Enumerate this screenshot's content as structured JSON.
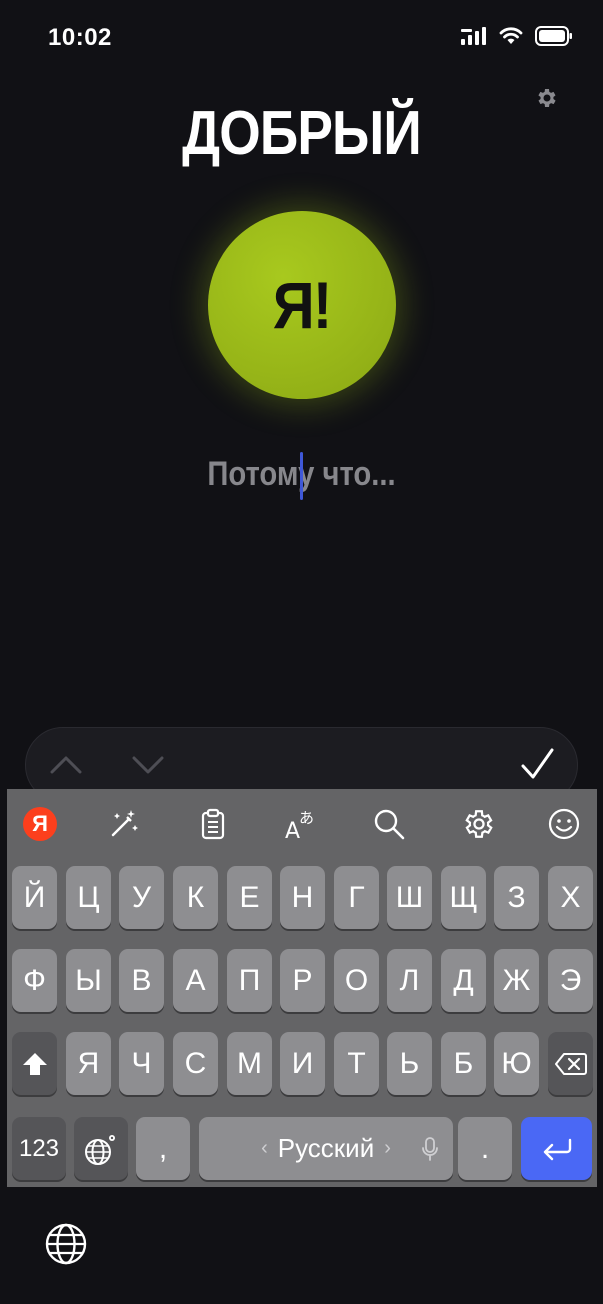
{
  "status": {
    "time": "10:02"
  },
  "screen": {
    "headline": "ДОБРЫЙ",
    "circle_label": "Я!",
    "prompt_text": "Потому что...",
    "accent_color": "#97b518",
    "caret_color": "#3f58d8"
  },
  "keyboard": {
    "language_label": "Русский",
    "toolbar_icons": [
      "yandex-logo",
      "magic-wand-icon",
      "clipboard-icon",
      "translate-icon",
      "search-icon",
      "gear-icon",
      "emoji-icon"
    ],
    "yandex_letter": "Я",
    "row1": [
      "Й",
      "Ц",
      "У",
      "К",
      "Е",
      "Н",
      "Г",
      "Ш",
      "Щ",
      "З",
      "Х"
    ],
    "row2": [
      "Ф",
      "Ы",
      "В",
      "А",
      "П",
      "Р",
      "О",
      "Л",
      "Д",
      "Ж",
      "Э"
    ],
    "row3": [
      "Я",
      "Ч",
      "С",
      "М",
      "И",
      "Т",
      "Ь",
      "Б",
      "Ю"
    ],
    "numbers_label": "123",
    "comma_label": ",",
    "period_label": ".",
    "left_arrow": "‹",
    "right_arrow": "›",
    "return_color": "#4a68f5"
  }
}
